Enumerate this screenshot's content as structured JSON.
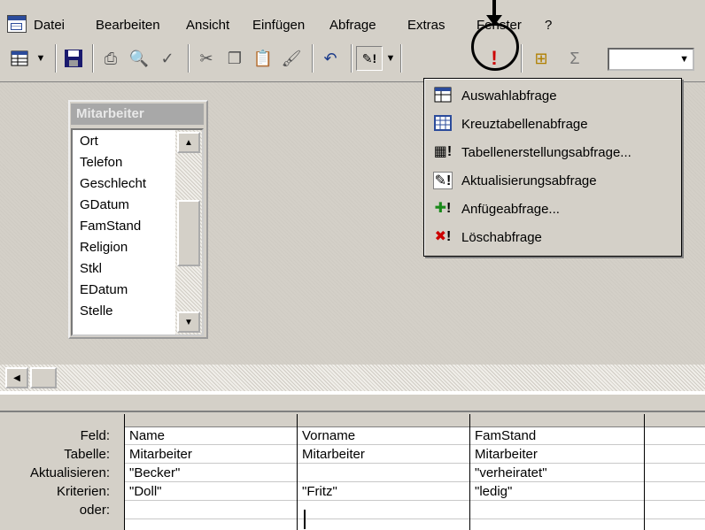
{
  "menu": {
    "items": [
      "Datei",
      "Bearbeiten",
      "Ansicht",
      "Einfügen",
      "Abfrage",
      "Extras",
      "Fenster",
      "?"
    ]
  },
  "toolbar": {
    "icons": [
      "view-icon",
      "save-icon",
      "print-icon",
      "print-preview-icon",
      "spelling-icon",
      "cut-icon",
      "copy-icon",
      "paste-icon",
      "format-painter-icon",
      "undo-icon",
      "query-type-icon",
      "run-icon",
      "show-table-icon",
      "totals-icon"
    ],
    "combo_value": ""
  },
  "table_box": {
    "title": "Mitarbeiter",
    "fields": [
      "Ort",
      "Telefon",
      "Geschlecht",
      "GDatum",
      "FamStand",
      "Religion",
      "Stkl",
      "EDatum",
      "Stelle"
    ]
  },
  "grid": {
    "row_labels": [
      "Feld:",
      "Tabelle:",
      "Aktualisieren:",
      "Kriterien:",
      "oder:"
    ],
    "columns": [
      {
        "feld": "Name",
        "tabelle": "Mitarbeiter",
        "aktualisieren": "\"Becker\"",
        "kriterien": "\"Doll\""
      },
      {
        "feld": "Vorname",
        "tabelle": "Mitarbeiter",
        "aktualisieren": "",
        "kriterien": "\"Fritz\""
      },
      {
        "feld": "FamStand",
        "tabelle": "Mitarbeiter",
        "aktualisieren": "\"verheiratet\"",
        "kriterien": "\"ledig\""
      }
    ]
  },
  "dropdown": {
    "items": [
      {
        "label": "Auswahlabfrage",
        "icon": "select-query-icon"
      },
      {
        "label": "Kreuztabellenabfrage",
        "icon": "crosstab-query-icon"
      },
      {
        "label": "Tabellenerstellungsabfrage...",
        "icon": "make-table-query-icon"
      },
      {
        "label": "Aktualisierungsabfrage",
        "icon": "update-query-icon"
      },
      {
        "label": "Anfügeabfrage...",
        "icon": "append-query-icon"
      },
      {
        "label": "Löschabfrage",
        "icon": "delete-query-icon"
      }
    ]
  },
  "colors": {
    "face": "#d4d0c8",
    "run_icon": "#cc0000",
    "highlight": "#000080"
  }
}
